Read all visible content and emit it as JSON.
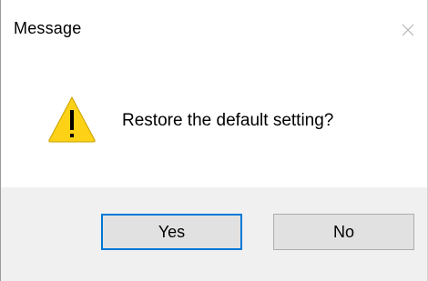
{
  "window": {
    "title": "Message"
  },
  "message": {
    "text": "Restore the default setting?",
    "icon": "warning-icon"
  },
  "buttons": {
    "yes_label": "Yes",
    "no_label": "No"
  },
  "colors": {
    "warning_fill": "#fcd116",
    "default_button_border": "#0078d7",
    "button_bar": "#f0f0f0"
  }
}
